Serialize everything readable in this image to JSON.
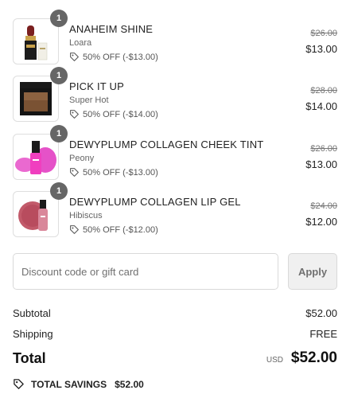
{
  "items": [
    {
      "quantity": "1",
      "name": "ANAHEIM SHINE",
      "variant": "Loara",
      "discount": "50% OFF (-$13.00)",
      "original_price": "$26.00",
      "price": "$13.00",
      "image": "lipstick-image"
    },
    {
      "quantity": "1",
      "name": "PICK IT UP",
      "variant": "Super Hot",
      "discount": "50% OFF (-$14.00)",
      "original_price": "$28.00",
      "price": "$14.00",
      "image": "bronzer-compact-image"
    },
    {
      "quantity": "1",
      "name": "DEWYPLUMP COLLAGEN CHEEK TINT",
      "variant": "Peony",
      "discount": "50% OFF (-$13.00)",
      "original_price": "$26.00",
      "price": "$13.00",
      "image": "cheek-tint-image"
    },
    {
      "quantity": "1",
      "name": "DEWYPLUMP COLLAGEN LIP GEL",
      "variant": "Hibiscus",
      "discount": "50% OFF (-$12.00)",
      "original_price": "$24.00",
      "price": "$12.00",
      "image": "lip-gel-image"
    }
  ],
  "discount_code": {
    "placeholder": "Discount code or gift card",
    "value": "",
    "apply_label": "Apply"
  },
  "summary": {
    "subtotal_label": "Subtotal",
    "subtotal_value": "$52.00",
    "shipping_label": "Shipping",
    "shipping_value": "FREE",
    "total_label": "Total",
    "currency": "USD",
    "total_value": "$52.00",
    "savings_label": "TOTAL SAVINGS",
    "savings_value": "$52.00"
  },
  "colors": {
    "badge": "#666666",
    "border": "#dedede",
    "apply_bg": "#f0f0f0",
    "text": "#222222"
  }
}
